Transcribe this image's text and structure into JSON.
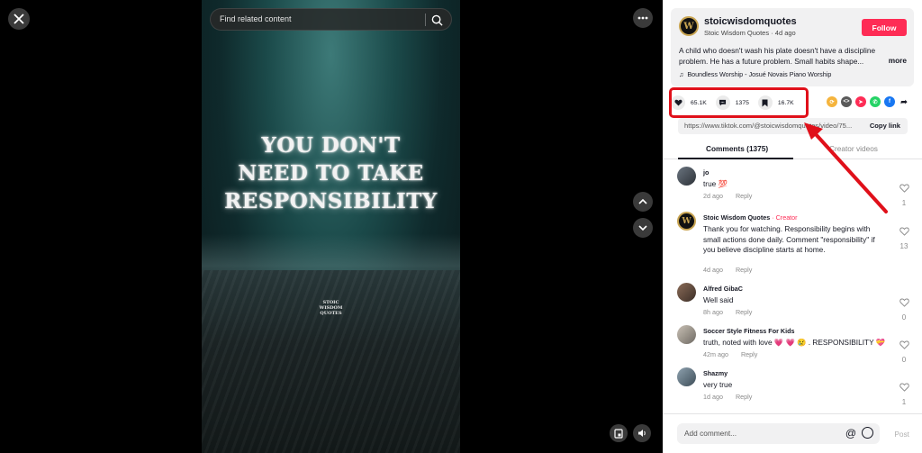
{
  "search": {
    "placeholder": "Find related content"
  },
  "video": {
    "lines": [
      "YOU DON'T",
      "NEED TO TAKE",
      "RESPONSIBILITY"
    ],
    "watermark": [
      "STOIC",
      "WISDOM",
      "QUOTES"
    ]
  },
  "author": {
    "avatar_letter": "W",
    "username": "stoicwisdomquotes",
    "subline": "Stoic Wisdom Quotes · 4d ago",
    "follow_label": "Follow",
    "description": "A child who doesn't wash his plate doesn't have a discipline problem. He has a future problem. Small habits shape...",
    "more_label": "more",
    "music": "Boundless Worship - Josué Novais Piano Worship"
  },
  "stats": {
    "likes": "65.1K",
    "comments": "1375",
    "saves": "16.7K"
  },
  "link": {
    "url": "https://www.tiktok.com/@stoicwisdomquotes/video/75...",
    "copy_label": "Copy link"
  },
  "tabs": {
    "comments": "Comments (1375)",
    "creator": "Creator videos"
  },
  "comments": [
    {
      "name": "jo",
      "creator": "",
      "text": "true 💯",
      "time": "2d ago",
      "reply": "Reply",
      "likes": "1"
    },
    {
      "name": "Stoic Wisdom Quotes",
      "creator": " · Creator",
      "text": "Thank you for watching. Responsibility begins with small actions done daily. Comment \"responsibility\" if you believe discipline starts at home.",
      "time": "4d ago",
      "reply": "Reply",
      "likes": "13"
    },
    {
      "name": "Alfred GibaC",
      "creator": "",
      "text": "Well said",
      "time": "8h ago",
      "reply": "Reply",
      "likes": "0"
    },
    {
      "name": "Soccer Style Fitness For Kids",
      "creator": "",
      "text": "truth, noted with love 💗 💗 😢 . RESPONSIBILITY 💝",
      "time": "42m ago",
      "reply": "Reply",
      "likes": "0"
    },
    {
      "name": "Shazmy",
      "creator": "",
      "text": "very true",
      "time": "1d ago",
      "reply": "Reply",
      "likes": "1"
    }
  ],
  "add_comment": {
    "placeholder": "Add comment...",
    "post_label": "Post"
  },
  "colors": {
    "accent": "#fe2c55",
    "highlight": "#e0101a"
  }
}
